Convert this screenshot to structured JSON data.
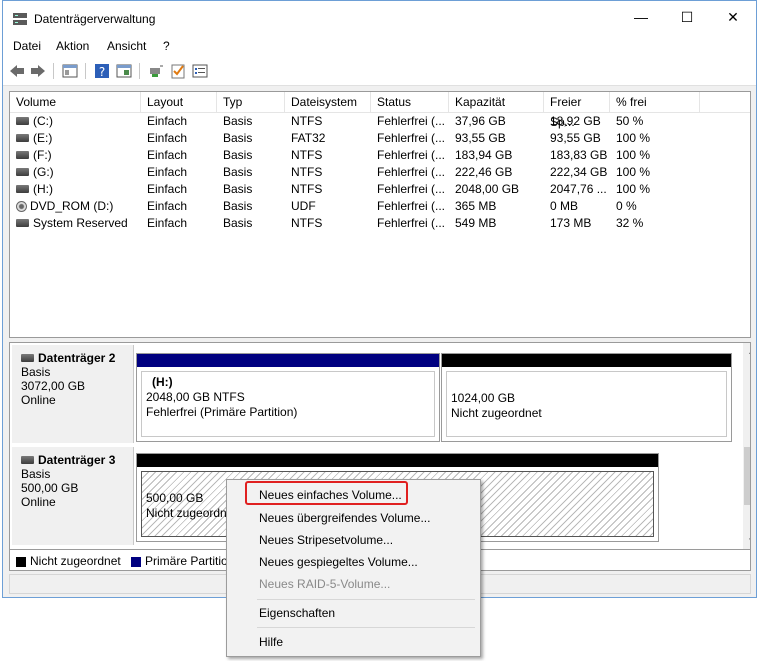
{
  "window": {
    "title": "Datenträgerverwaltung",
    "minimize": "—",
    "maximize": "☐",
    "close": "✕"
  },
  "menu": [
    "Datei",
    "Aktion",
    "Ansicht",
    "?"
  ],
  "toolbar": {
    "icons": [
      "back-icon",
      "forward-icon",
      "console-icon",
      "help-icon",
      "properties-icon",
      "connect-icon",
      "check-icon",
      "list-icon"
    ]
  },
  "columns": [
    "Volume",
    "Layout",
    "Typ",
    "Dateisystem",
    "Status",
    "Kapazität",
    "Freier Sp...",
    "% frei"
  ],
  "volumes": [
    {
      "volume": "(C:)",
      "layout": "Einfach",
      "typ": "Basis",
      "fs": "NTFS",
      "status": "Fehlerfrei (...",
      "cap": "37,96 GB",
      "free": "18,92 GB",
      "pct": "50 %",
      "icon": "drive"
    },
    {
      "volume": "(E:)",
      "layout": "Einfach",
      "typ": "Basis",
      "fs": "FAT32",
      "status": "Fehlerfrei (...",
      "cap": "93,55 GB",
      "free": "93,55 GB",
      "pct": "100 %",
      "icon": "drive"
    },
    {
      "volume": "(F:)",
      "layout": "Einfach",
      "typ": "Basis",
      "fs": "NTFS",
      "status": "Fehlerfrei (...",
      "cap": "183,94 GB",
      "free": "183,83 GB",
      "pct": "100 %",
      "icon": "drive"
    },
    {
      "volume": "(G:)",
      "layout": "Einfach",
      "typ": "Basis",
      "fs": "NTFS",
      "status": "Fehlerfrei (...",
      "cap": "222,46 GB",
      "free": "222,34 GB",
      "pct": "100 %",
      "icon": "drive"
    },
    {
      "volume": "(H:)",
      "layout": "Einfach",
      "typ": "Basis",
      "fs": "NTFS",
      "status": "Fehlerfrei (...",
      "cap": "2048,00 GB",
      "free": "2047,76 ...",
      "pct": "100 %",
      "icon": "drive"
    },
    {
      "volume": "DVD_ROM (D:)",
      "layout": "Einfach",
      "typ": "Basis",
      "fs": "UDF",
      "status": "Fehlerfrei (...",
      "cap": "365 MB",
      "free": "0 MB",
      "pct": "0 %",
      "icon": "cd"
    },
    {
      "volume": "System Reserved",
      "layout": "Einfach",
      "typ": "Basis",
      "fs": "NTFS",
      "status": "Fehlerfrei (...",
      "cap": "549 MB",
      "free": "173 MB",
      "pct": "32 %",
      "icon": "drive"
    }
  ],
  "disks": [
    {
      "name": "Datenträger 2",
      "type": "Basis",
      "size": "3072,00 GB",
      "state": "Online",
      "partitions": [
        {
          "title": "(H:)",
          "line1": "2048,00 GB NTFS",
          "line2": "Fehlerfrei (Primäre Partition)",
          "color": "#000080"
        },
        {
          "title": "",
          "line1": "1024,00 GB",
          "line2": "Nicht zugeordnet",
          "color": "#000000"
        }
      ]
    },
    {
      "name": "Datenträger 3",
      "type": "Basis",
      "size": "500,00 GB",
      "state": "Online",
      "partitions": [
        {
          "title": "",
          "line1": "500,00 GB",
          "line2": "Nicht zugeordn",
          "color": "#000000"
        }
      ]
    }
  ],
  "legend": [
    {
      "label": "Nicht zugeordnet",
      "color": "#000000"
    },
    {
      "label": "Primäre Partitio",
      "color": "#000080"
    }
  ],
  "context_menu": {
    "items": [
      {
        "label": "Neues einfaches Volume...",
        "enabled": true
      },
      {
        "label": "Neues übergreifendes Volume...",
        "enabled": true
      },
      {
        "label": "Neues Stripesetvolume...",
        "enabled": true
      },
      {
        "label": "Neues gespiegeltes Volume...",
        "enabled": true
      },
      {
        "label": "Neues RAID-5-Volume...",
        "enabled": false
      },
      {
        "label": "Eigenschaften",
        "enabled": true
      },
      {
        "label": "Hilfe",
        "enabled": true
      }
    ]
  },
  "scroll": {
    "up": "▲",
    "down": "▼"
  }
}
